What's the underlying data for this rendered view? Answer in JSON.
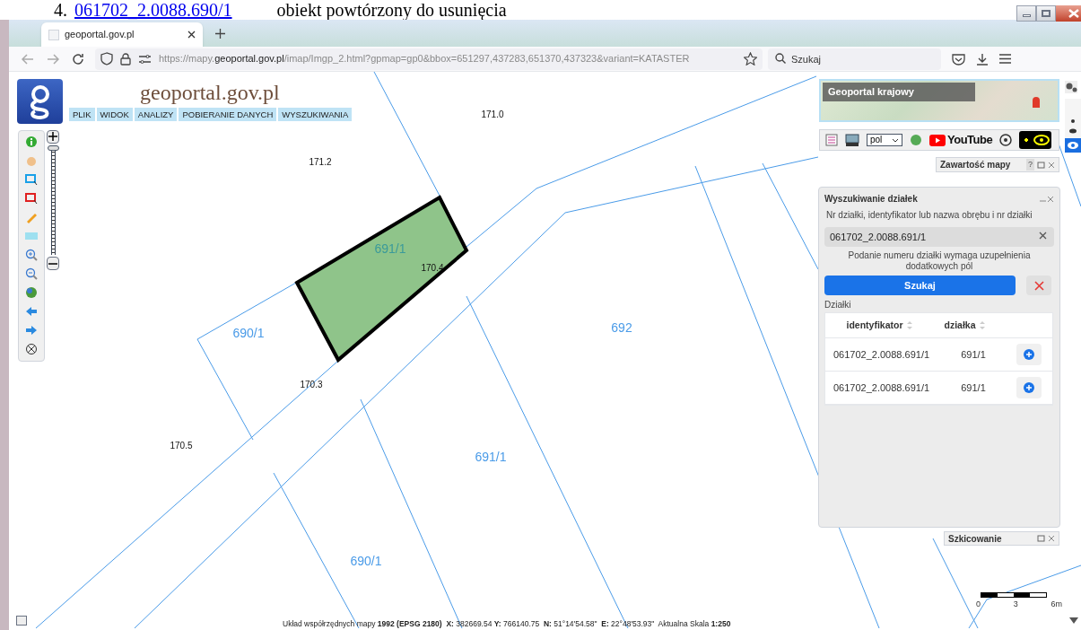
{
  "document_line": {
    "number": "4.",
    "link": "061702_2.0088.690/1",
    "text": "obiekt powtórzony do usunięcia"
  },
  "browser": {
    "tabs": [
      {
        "title": "geoportal.gov.pl",
        "selected": true
      }
    ],
    "url": {
      "scheme": "https://mapy.",
      "host": "geoportal.gov.pl",
      "path": "/imap/Imgp_2.html?gpmap=gp0&bbox=651297,437283,651370,437323&variant=KATASTER"
    },
    "search_placeholder": "Szukaj"
  },
  "header": {
    "site_title": "geoportal.gov.pl",
    "menu": [
      "PLIK",
      "WIDOK",
      "ANALIZY",
      "POBIERANIE DANYCH",
      "WYSZUKIWANIA"
    ]
  },
  "map": {
    "parcel_labels": [
      {
        "text": "691/1",
        "highlighted": true
      },
      {
        "text": "690/1",
        "highlighted": false
      },
      {
        "text": "692",
        "highlighted": false
      },
      {
        "text": "691/1",
        "highlighted": false
      },
      {
        "text": "690/1",
        "highlighted": false
      }
    ],
    "heights": [
      "171.0",
      "171.2",
      "170.4",
      "170.3",
      "170.5"
    ]
  },
  "zoom_slider": {
    "level": 1
  },
  "overview_map": {
    "title": "Geoportal krajowy"
  },
  "tools": {
    "language": "pol",
    "video_label": "YouTube"
  },
  "map_contents_panel": {
    "title": "Zawartość mapy",
    "help": "?"
  },
  "parcel_search": {
    "title": "Wyszukiwanie działek",
    "field_label": "Nr działki, identyfikator lub nazwa obrębu i nr działki",
    "value": "061702_2.0088.691/1",
    "hint": "Podanie numeru działki wymaga uzupełnienia dodatkowych pól",
    "search_button": "Szukaj",
    "results_label": "Działki",
    "columns": [
      "identyfikator",
      "działka"
    ],
    "rows": [
      {
        "identifier": "061702_2.0088.691/1",
        "parcel": "691/1"
      },
      {
        "identifier": "061702_2.0088.691/1",
        "parcel": "691/1"
      }
    ]
  },
  "sketch_panel": {
    "title": "Szkicowanie"
  },
  "status_bar": "Układ współrzędnych mapy **1992 (EPSG 2180)**  **X:** 382669.54 **Y:** 766140.75  **N:** 51°14'54.58\"  **E:** 22°48'53.93\"  Aktualna Skala **1:250**",
  "scale_bar": [
    "0",
    "3",
    "6m"
  ]
}
